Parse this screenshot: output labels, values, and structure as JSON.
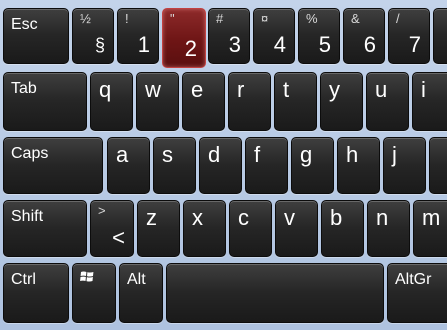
{
  "row1": {
    "esc": "Esc",
    "sect_top": "½",
    "sect_main": "§",
    "k1_top": "!",
    "k1_main": "1",
    "k2_top": "\"",
    "k2_main": "2",
    "k3_top": "#",
    "k3_main": "3",
    "k4_top": "¤",
    "k4_main": "4",
    "k5_top": "%",
    "k5_main": "5",
    "k6_top": "&",
    "k6_main": "6",
    "k7_top": "/",
    "k7_main": "7"
  },
  "row2": {
    "tab": "Tab",
    "q": "q",
    "w": "w",
    "e": "e",
    "r": "r",
    "t": "t",
    "y": "y",
    "u": "u",
    "i": "i"
  },
  "row3": {
    "caps": "Caps",
    "a": "a",
    "s": "s",
    "d": "d",
    "f": "f",
    "g": "g",
    "h": "h",
    "j": "j"
  },
  "row4": {
    "shift": "Shift",
    "lt_top": ">",
    "lt_main": "<",
    "z": "z",
    "x": "x",
    "c": "c",
    "v": "v",
    "b": "b",
    "n": "n",
    "m": "m"
  },
  "row5": {
    "ctrl": "Ctrl",
    "win_icon": "windows-logo-icon",
    "alt": "Alt",
    "space": "",
    "altgr": "AltGr"
  },
  "state": {
    "pressed_key": "2",
    "pressed_color": "#7a1a1a",
    "key_color": "#262626",
    "background_color": "#b9cbe3"
  }
}
